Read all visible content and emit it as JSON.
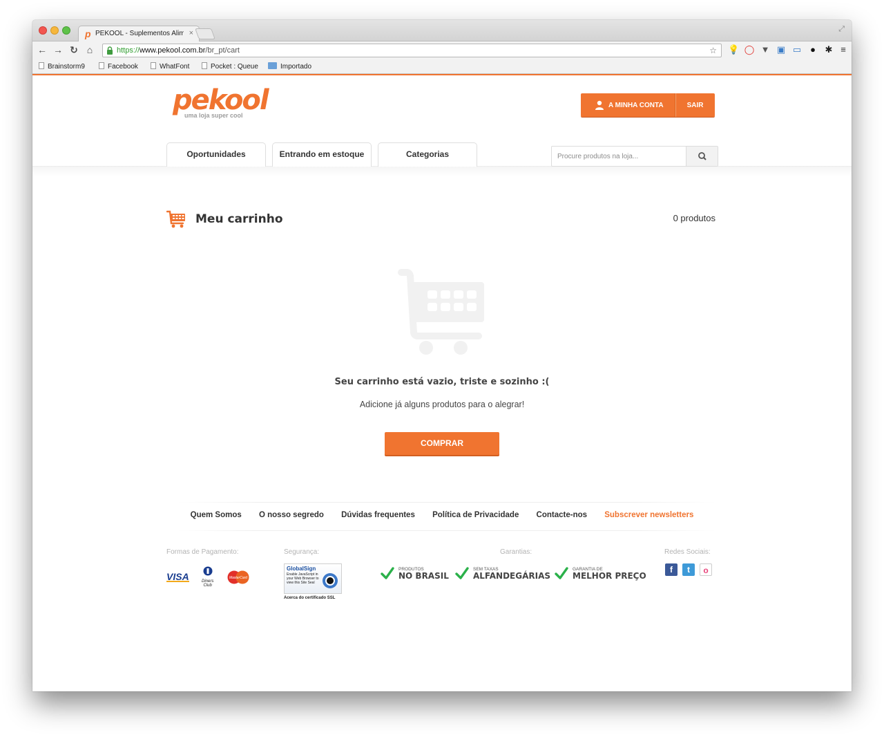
{
  "browser": {
    "tab_title": "PEKOOL - Suplementos Alim",
    "tab_close": "×",
    "url_scheme": "https://",
    "url_host": "www.pekool.com.br",
    "url_path": "/br_pt/cart",
    "bookmarks": [
      "Brainstorm9",
      "Facebook",
      "WhatFont",
      "Pocket : Queue",
      "Importado"
    ]
  },
  "header": {
    "logo_text": "pekool",
    "logo_tagline": "uma loja super cool",
    "account_label": "A MINHA CONTA",
    "logout_label": "SAIR",
    "nav_tabs": [
      "Oportunidades",
      "Entrando em estoque",
      "Categorias"
    ],
    "search_placeholder": "Procure produtos na loja..."
  },
  "cart": {
    "title": "Meu carrinho",
    "count": "0 produtos",
    "empty_title": "Seu carrinho está vazio, triste e sozinho :(",
    "empty_subtitle": "Adicione já alguns produtos para o alegrar!",
    "buy_label": "COMPRAR"
  },
  "footer": {
    "links": [
      "Quem Somos",
      "O nosso segredo",
      "Dúvidas frequentes",
      "Política de Privacidade",
      "Contacte-nos",
      "Subscrever newsletters"
    ],
    "payment_heading": "Formas de Pagamento:",
    "security_heading": "Segurança:",
    "guarantees_heading": "Garantias:",
    "social_heading": "Redes Sociais:",
    "payment_visa": "VISA",
    "payment_diners": "Diners Club",
    "payment_master": "MasterCard",
    "globalsign_title": "GlobalSign",
    "globalsign_text": "Enable JavaScript in your Web Browser to view this Site Seal",
    "globalsign_caption": "Acerca do certificado SSL",
    "guarantees": [
      {
        "small": "PRODUTOS",
        "big": "NO BRASIL"
      },
      {
        "small": "SEM TAXAS",
        "big": "ALFANDEGÁRIAS"
      },
      {
        "small": "GARANTIA DE",
        "big": "MELHOR PREÇO"
      }
    ]
  },
  "colors": {
    "accent": "#f07430",
    "check_green": "#2bb14a",
    "facebook": "#3b5998",
    "twitter": "#3e9ad8",
    "flickr_pink": "#e8467c"
  },
  "icons": [
    "back-icon",
    "forward-icon",
    "reload-icon",
    "home-icon",
    "lock-icon",
    "star-icon",
    "user-icon",
    "search-icon",
    "cart-icon",
    "check-icon",
    "facebook-icon",
    "twitter-icon",
    "flickr-icon"
  ]
}
